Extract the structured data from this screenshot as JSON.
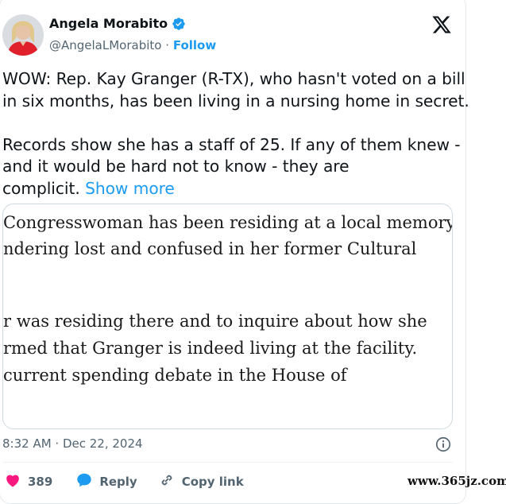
{
  "author": {
    "name": "Angela Morabito",
    "handle": "@AngelaLMorabito",
    "separator": "·",
    "follow_label": "Follow"
  },
  "tweet": {
    "line1": "WOW: Rep. Kay Granger (R-TX), who hasn't voted on a bill",
    "line2": "in six months, has been living in a nursing home in secret.",
    "line3": "Records show she has a staff of 25. If any of them knew -",
    "line4": "and it would be hard not to know - they are",
    "line5": "complicit.",
    "show_more": "Show more"
  },
  "quote_excerpt": {
    "line1": "Congresswoman has been residing at a local memory",
    "line2": "ndering lost and confused in her former Cultural",
    "line3": "r was residing there and to inquire about how she",
    "line4": "rmed that Granger is indeed living at the facility.",
    "line5": "current spending debate in the House of"
  },
  "meta": {
    "timestamp": "8:32 AM · Dec 22, 2024"
  },
  "actions": {
    "likes": "389",
    "reply_label": "Reply",
    "copy_link_label": "Copy link"
  },
  "watermark": "www.365jz.com",
  "icons": {
    "verified": "verified-badge-icon",
    "x_logo": "x-logo-icon",
    "info": "info-icon",
    "like": "heart-icon",
    "reply": "speech-bubble-icon",
    "link": "link-icon"
  },
  "colors": {
    "accent": "#1d9bf0",
    "like": "#f91880",
    "text_primary": "#0f1419",
    "text_secondary": "#536471"
  }
}
